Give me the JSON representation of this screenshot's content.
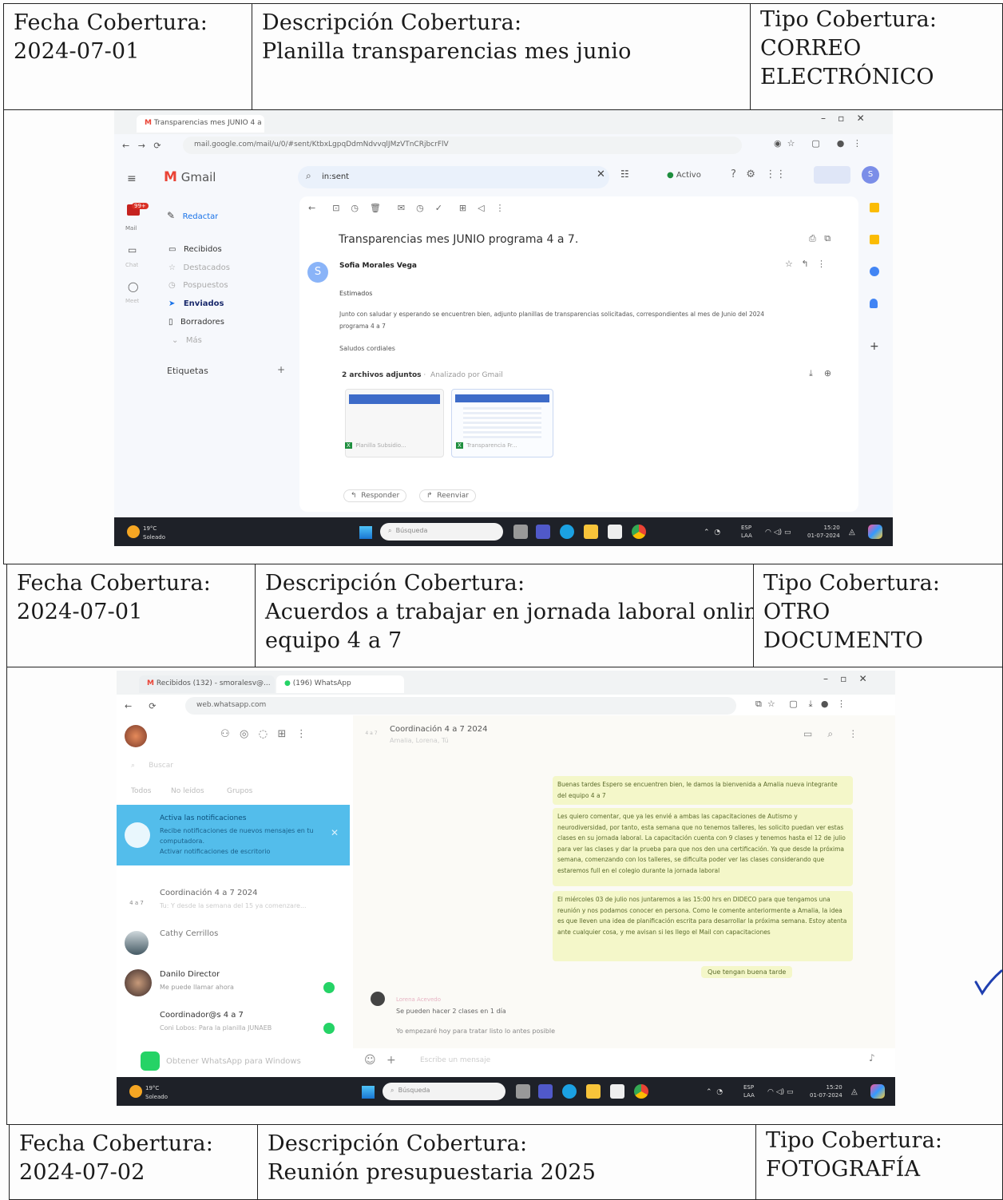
{
  "labels": {
    "fecha": "Fecha Cobertura:",
    "descripcion": "Descripción Cobertura:",
    "tipo": "Tipo Cobertura:"
  },
  "entries": [
    {
      "fecha": "2024-07-01",
      "descripcion": "Planilla transparencias mes junio",
      "tipo_line1": "CORREO",
      "tipo_line2": "ELECTRÓNICO"
    },
    {
      "fecha": "2024-07-01",
      "descripcion_line1": "Acuerdos a trabajar en jornada laboral online,",
      "descripcion_line2": "equipo 4 a 7",
      "tipo_line1": "OTRO DOCUMENTO"
    },
    {
      "fecha": "2024-07-02",
      "descripcion": "Reunión presupuestaria 2025",
      "tipo_line1": "FOTOGRAFÍA"
    }
  ],
  "gmail": {
    "tab_title": "Transparencias mes JUNIO 4 a",
    "url": "mail.google.com/mail/u/0/#sent/KtbxLgpqDdmNdvvqlJMzVTnCRjbcrFlV",
    "app_name": "Gmail",
    "search_value": "in:sent",
    "status": "Activo",
    "compose": "Redactar",
    "rail": [
      "Mail",
      "Chat",
      "Meet"
    ],
    "badge": "99+",
    "nav": [
      "Recibidos",
      "Destacados",
      "Pospuestos",
      "Enviados",
      "Borradores",
      "Más"
    ],
    "labels_heading": "Etiquetas",
    "subject": "Transparencias mes JUNIO programa 4 a 7.",
    "sender": "Sofia Morales Vega",
    "avatar_letter": "S",
    "greeting": "Estimados",
    "body_line1": "Junto con saludar y esperando se encuentren bien, adjunto planillas de transparencias solicitadas, correspondientes al mes de Junio del 2024",
    "body_line2": "programa 4 a 7",
    "closing": "Saludos cordiales",
    "attachments_heading": "2 archivos adjuntos",
    "attachments_note": "Analizado por Gmail",
    "attachment1": "Planilla Subsidio...",
    "attachment2": "Transparencia Fr...",
    "reply": "Responder",
    "forward": "Reenviar"
  },
  "whatsapp": {
    "tab1": "Recibidos (132) - smoralesv@...",
    "tab2": "(196) WhatsApp",
    "url": "web.whatsapp.com",
    "search_placeholder": "Buscar",
    "filters": [
      "Todos",
      "No leídos",
      "Grupos"
    ],
    "notif_title": "Activa las notificaciones",
    "notif_body": "Recibe notificaciones de nuevos mensajes en tu computadora.",
    "notif_link": "Activar notificaciones de escritorio",
    "chats": [
      {
        "name": "Coordinación 4 a 7 2024",
        "preview": "Tu: Y desde la semana del 15 ya comenzare...",
        "avatar": "4 a 7"
      },
      {
        "name": "Cathy Cerrillos",
        "preview": "",
        "avatar": ""
      },
      {
        "name": "Danilo Director",
        "preview": "Me puede llamar ahora",
        "avatar": ""
      },
      {
        "name": "Coordinador@s 4 a 7",
        "preview": "Coni Lobos: Para la planilla JUNAEB",
        "avatar": ""
      }
    ],
    "get_app": "Obtener WhatsApp para Windows",
    "conv_title": "Coordinación 4 a 7 2024",
    "conv_members": "Amalia, Lorena, Tú",
    "msg1": "Buenas tardes Espero se encuentren bien, le damos la bienvenida a Amalia nueva integrante del equipo 4 a 7",
    "msg2": "Les quiero comentar, que ya les envié a ambas las capacitaciones de Autismo y neurodiversidad, por tanto, esta semana que no tenemos talleres, les solicito puedan ver estas clases en su jornada laboral. La capacitación cuenta con 9 clases y tenemos hasta el 12 de julio para ver las clases y dar la prueba para que nos den una certificación. Ya que desde la próxima semana, comenzando con los talleres, se dificulta poder ver las clases considerando que estaremos full en el colegio durante la jornada laboral",
    "msg3": "El miércoles 03 de julio nos juntaremos a las 15:00 hrs en DIDECO para que tengamos una reunión y nos podamos conocer en persona. Como le comente anteriormente a Amalia, la idea es que lleven una idea de planificación escrita para desarrollar la próxima semana. Estoy atenta ante cualquier cosa, y me avisan si les llego el Mail con capacitaciones",
    "msg4": "Que tengan buena tarde",
    "reply_name": "Lorena Acevedo",
    "reply1": "Se pueden hacer 2 clases en 1 día",
    "reply2": "Yo empezaré hoy para tratar listo lo antes posible",
    "input_placeholder": "Escribe un mensaje"
  },
  "taskbar": {
    "weather_temp": "19°C",
    "weather_desc": "Soleado",
    "search": "Búsqueda",
    "lang1": "ESP",
    "lang2": "LAA",
    "time": "15:20",
    "date": "01-07-2024"
  },
  "colors": {
    "gmail_red": "#ea4335",
    "gmail_blue": "#1a73e8",
    "whatsapp_green": "#25d366",
    "chat_bubble": "#f4f7c9",
    "taskbar": "#1e2128",
    "checkmark": "#1f3fb0"
  }
}
